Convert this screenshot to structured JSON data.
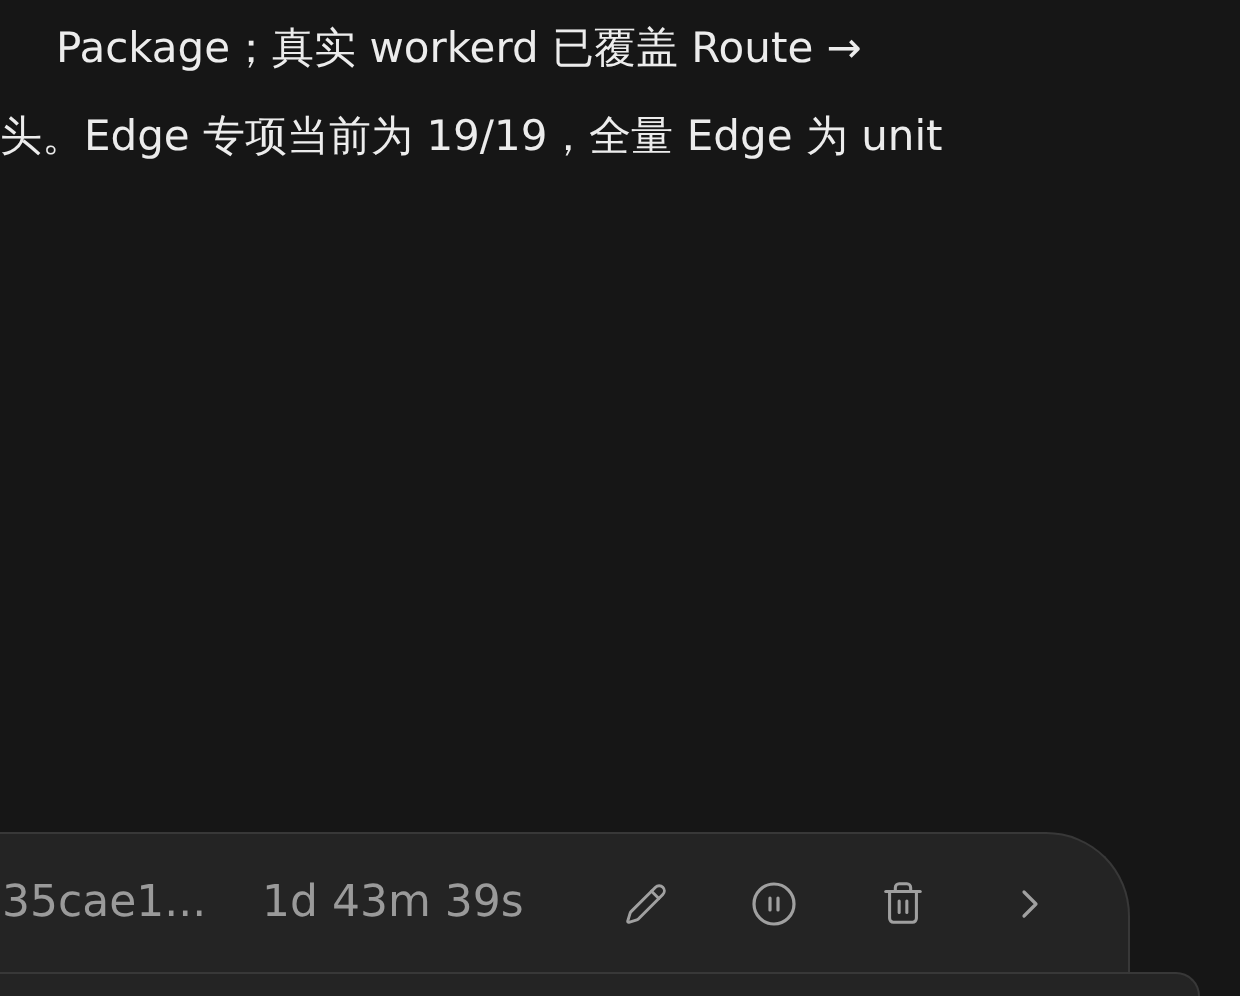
{
  "message": {
    "lines": [
      "Package；真实 workerd 已覆盖 Route →",
      "头。Edge 专项当前为 19/19，全量 Edge 为 unit"
    ]
  },
  "task_card": {
    "id": "35cae1...",
    "elapsed": "1d 43m 39s",
    "paused": false
  }
}
